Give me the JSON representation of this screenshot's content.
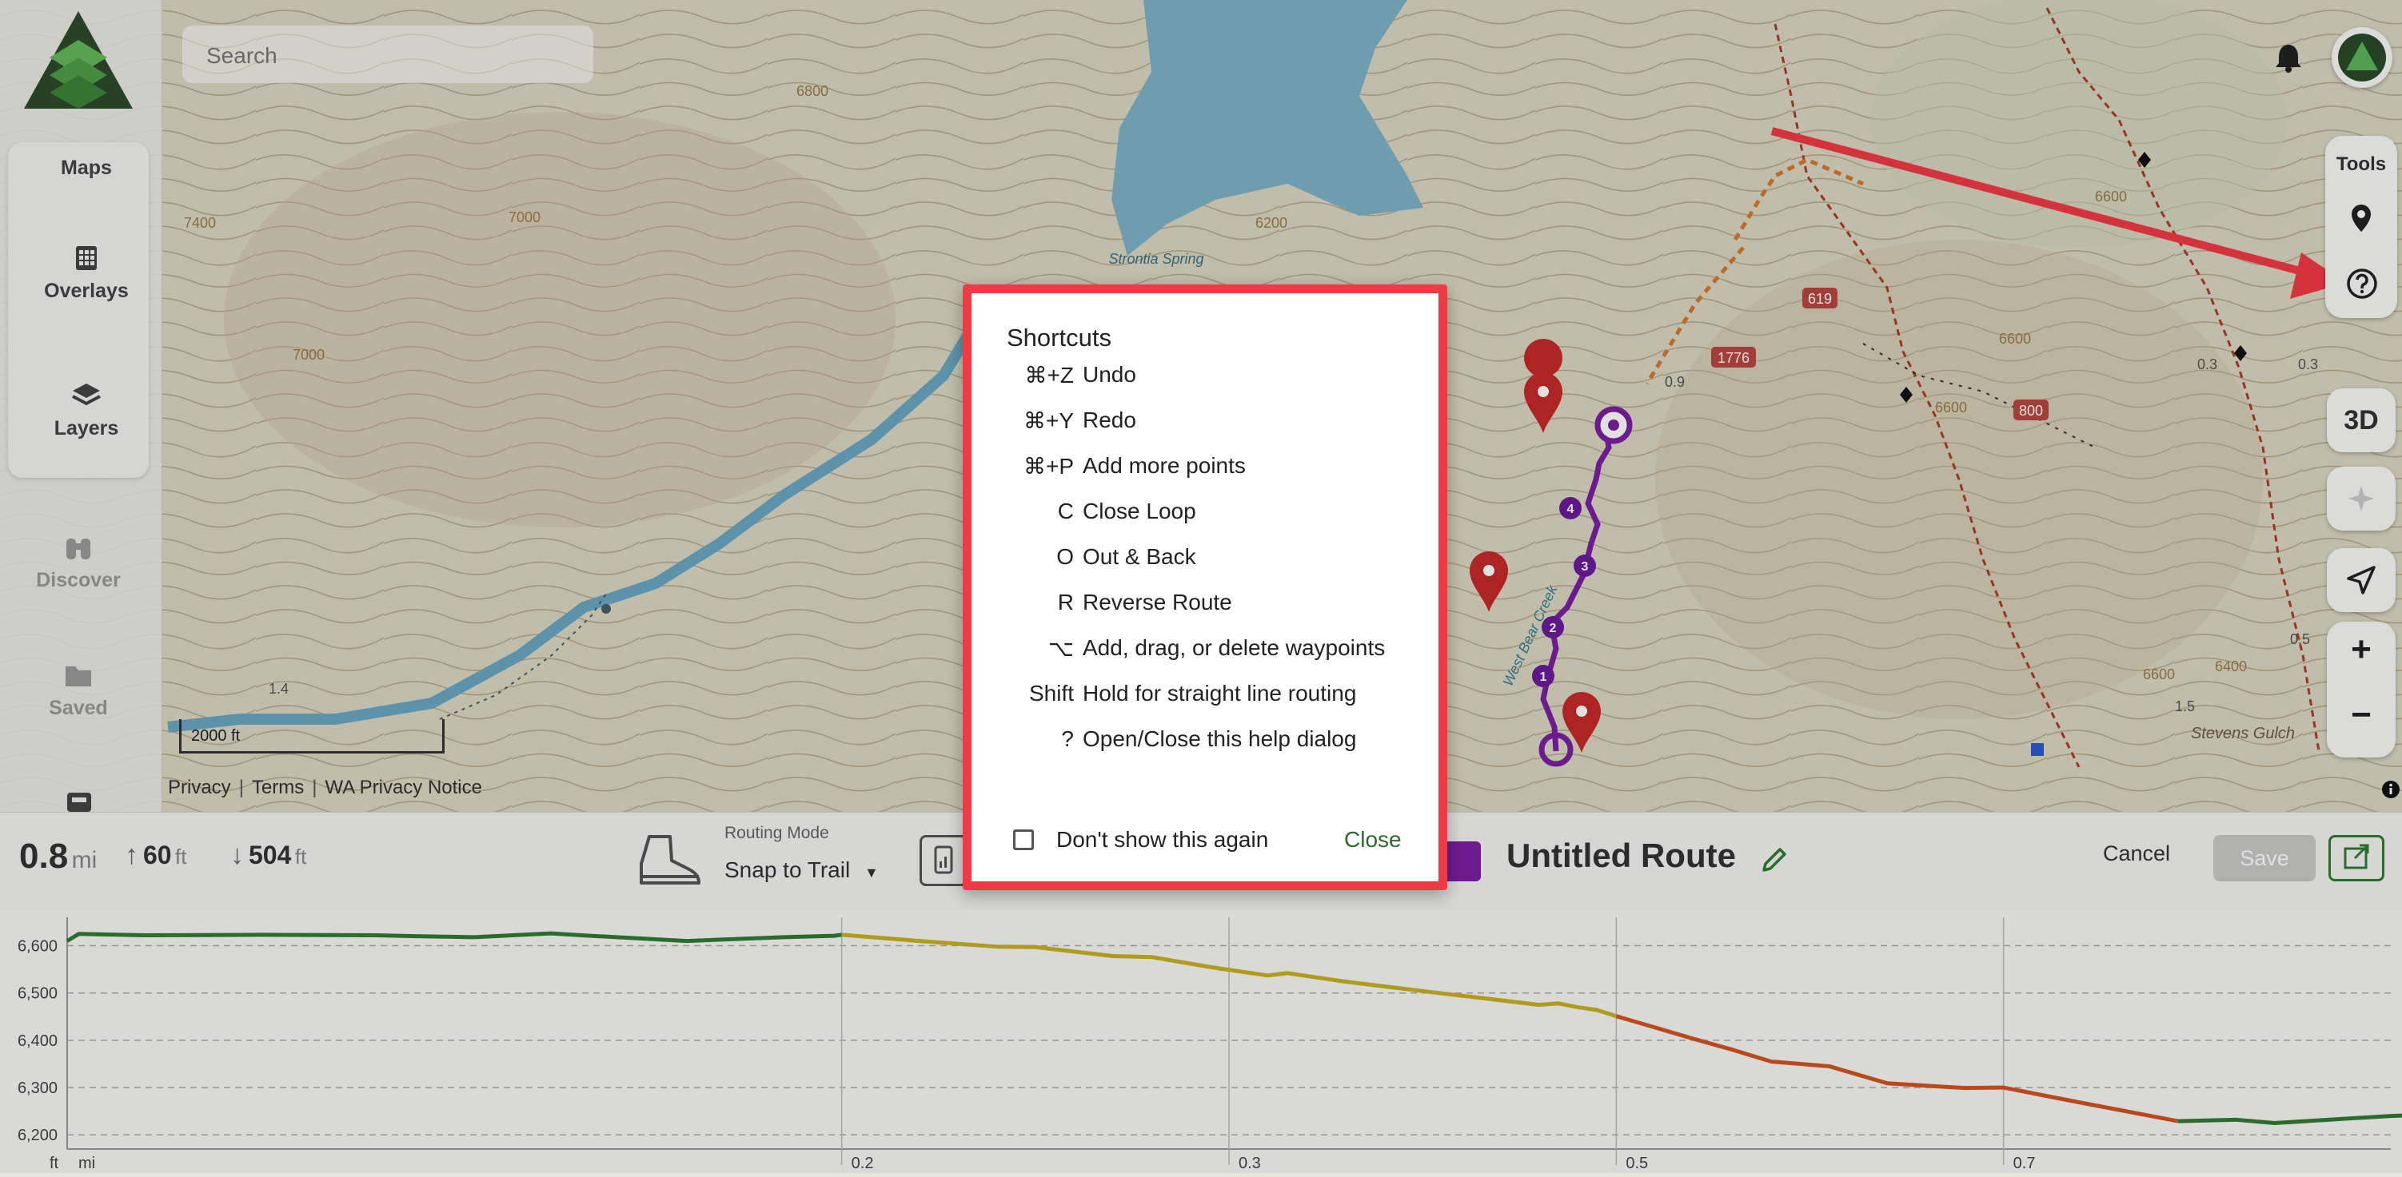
{
  "app": {
    "search_placeholder": "Search",
    "sidebar": {
      "maps_label": "Maps",
      "items": [
        {
          "label": "Overlays",
          "icon": "grid-icon"
        },
        {
          "label": "Layers",
          "icon": "layers-icon"
        },
        {
          "label": "Discover",
          "icon": "binoculars-icon"
        },
        {
          "label": "Saved",
          "icon": "folder-icon"
        }
      ]
    },
    "tools": {
      "label": "Tools",
      "three_d": "3D",
      "zoom_in": "+",
      "zoom_out": "−"
    },
    "map_footer": {
      "links": [
        "Privacy",
        "Terms",
        "WA Privacy Notice"
      ],
      "scale_label": "2000 ft"
    },
    "map_labels": {
      "spring": "Strontia Spring",
      "gulch": "Stevens Gulch",
      "creek": "West Bear Creek",
      "roads": [
        "619",
        "1776",
        "800"
      ],
      "contours": [
        "6800",
        "7400",
        "7000",
        "7000",
        "6200",
        "6600",
        "6600",
        "6600",
        "6600",
        "6400",
        "1.4",
        "0.9",
        "0.3",
        "0.5",
        "1.5",
        "0.3"
      ],
      "waypoints": [
        "1",
        "2",
        "3",
        "4"
      ]
    },
    "stats": {
      "distance": "0.8",
      "distance_unit": "mi",
      "gain": "60",
      "gain_unit": "ft",
      "loss": "504",
      "loss_unit": "ft"
    },
    "routing": {
      "label": "Routing Mode",
      "value": "Snap to Trail"
    },
    "route": {
      "name": "Untitled Route",
      "color": "#7b1fa2",
      "cancel_label": "Cancel",
      "save_label": "Save"
    },
    "dialog": {
      "title": "Shortcuts",
      "shortcuts": [
        {
          "key": "⌘+Z",
          "desc": "Undo"
        },
        {
          "key": "⌘+Y",
          "desc": "Redo"
        },
        {
          "key": "⌘+P",
          "desc": "Add more points"
        },
        {
          "key": "C",
          "desc": "Close Loop"
        },
        {
          "key": "O",
          "desc": "Out & Back"
        },
        {
          "key": "R",
          "desc": "Reverse Route"
        },
        {
          "key": "⌥",
          "desc": "Add, drag, or delete waypoints"
        },
        {
          "key": "Shift",
          "desc": "Hold for straight line routing"
        },
        {
          "key": "?",
          "desc": "Open/Close this help dialog"
        }
      ],
      "checkbox_label": "Don't show this again",
      "checkbox_checked": false,
      "close_label": "Close",
      "border_color": "#f23a45"
    }
  },
  "chart_data": {
    "type": "line",
    "xlabel": "mi",
    "ylabel": "ft",
    "x_ticks": [
      "0.2",
      "0.3",
      "0.5",
      "0.7"
    ],
    "y_ticks": [
      "6,600",
      "6,500",
      "6,400",
      "6,300",
      "6,200"
    ],
    "x_tick_values": [
      0.2,
      0.3,
      0.4,
      0.5
    ],
    "ylim": [
      6170,
      6660
    ],
    "xlim": [
      0.0,
      0.6
    ],
    "grid": true,
    "series": [
      {
        "color": "#2e7d32",
        "x": [
          0.0,
          0.003,
          0.02,
          0.05,
          0.08,
          0.09,
          0.105,
          0.125,
          0.135,
          0.16,
          0.185,
          0.198,
          0.2
        ],
        "y": [
          6610,
          6625,
          6622,
          6623,
          6622,
          6620,
          6618,
          6626,
          6621,
          6610,
          6618,
          6621,
          6623
        ]
      },
      {
        "color": "#c9b11f",
        "x": [
          0.2,
          0.22,
          0.24,
          0.25,
          0.27,
          0.28,
          0.295,
          0.31,
          0.315,
          0.33,
          0.35,
          0.38,
          0.385,
          0.39,
          0.395,
          0.4
        ],
        "y": [
          6623,
          6610,
          6598,
          6597,
          6578,
          6576,
          6555,
          6537,
          6542,
          6524,
          6504,
          6475,
          6478,
          6470,
          6464,
          6451
        ]
      },
      {
        "color": "#d35420",
        "x": [
          0.4,
          0.41,
          0.42,
          0.43,
          0.44,
          0.455,
          0.47,
          0.49,
          0.5,
          0.52,
          0.545
        ],
        "y": [
          6451,
          6427,
          6403,
          6380,
          6355,
          6345,
          6309,
          6299,
          6300,
          6268,
          6229
        ]
      },
      {
        "color": "#2e7d32",
        "x": [
          0.545,
          0.56,
          0.57,
          0.58,
          0.6,
          0.62,
          0.63,
          0.66,
          0.68,
          0.7,
          0.73,
          0.76,
          0.79,
          0.82,
          0.85,
          0.88,
          0.9
        ],
        "y": [
          6229,
          6232,
          6225,
          6230,
          6240,
          6245,
          6243,
          6238,
          6232,
          6228,
          6228,
          6200,
          6197,
          6190,
          6190,
          6188,
          6210
        ]
      }
    ]
  }
}
